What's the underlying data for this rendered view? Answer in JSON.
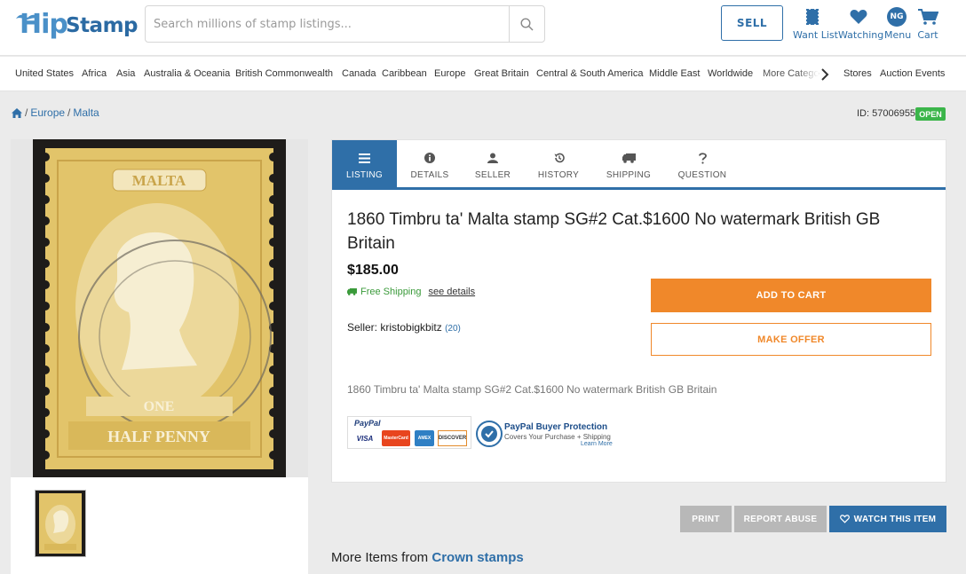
{
  "header": {
    "logo_part1": "Hip",
    "logo_part2": "Stamp",
    "search_placeholder": "Search millions of stamp listings...",
    "sell_label": "SELL",
    "icons": [
      {
        "label": "Want List",
        "icon": "stamp-icon"
      },
      {
        "label": "Watching",
        "icon": "heart-icon"
      },
      {
        "label": "Menu",
        "icon": "avatar",
        "initials": "NG"
      },
      {
        "label": "Cart",
        "icon": "cart-icon"
      }
    ]
  },
  "categories": [
    "United States",
    "Africa",
    "Asia",
    "Australia & Oceania",
    "British Commonwealth",
    "Canada",
    "Caribbean",
    "Europe",
    "Great Britain",
    "Central & South America",
    "Middle East",
    "Worldwide",
    "More Catego",
    "Stores",
    "Auction Events"
  ],
  "breadcrumb": {
    "home_icon": "home-icon",
    "items": [
      "Europe",
      "Malta"
    ]
  },
  "listing_id": "ID: 57006955",
  "status_badge": "OPEN",
  "tabs": [
    {
      "label": "LISTING",
      "icon": "list-icon",
      "active": true
    },
    {
      "label": "DETAILS",
      "icon": "info-icon"
    },
    {
      "label": "SELLER",
      "icon": "user-icon"
    },
    {
      "label": "HISTORY",
      "icon": "history-icon"
    },
    {
      "label": "SHIPPING",
      "icon": "truck-icon"
    },
    {
      "label": "QUESTION",
      "icon": "question-icon"
    }
  ],
  "listing": {
    "title": "1860 Timbru ta' Malta stamp SG#2 Cat.$1600 No watermark British GB Britain",
    "price": "$185.00",
    "free_shipping": "Free Shipping",
    "see_details": "see details",
    "seller_label": "Seller:",
    "seller_name": "kristobigkbitz",
    "seller_count": "(20)",
    "add_to_cart": "ADD TO CART",
    "make_offer": "MAKE OFFER",
    "description": "1860 Timbru ta' Malta stamp SG#2 Cat.$1600 No watermark British GB Britain"
  },
  "image_caption": {
    "stamp_top": "MALTA",
    "stamp_mid": "ONE",
    "stamp_bottom": "HALF PENNY"
  },
  "payment": {
    "paypal": "PayPal",
    "cards": [
      "VISA",
      "MasterCard",
      "AMEX",
      "DISCOVER"
    ],
    "protection_title": "PayPal Buyer Protection",
    "protection_sub": "Covers Your Purchase + Shipping",
    "learn_more": "Learn More"
  },
  "actions": {
    "print": "PRINT",
    "report": "REPORT ABUSE",
    "watch": "WATCH THIS ITEM"
  },
  "more_items": {
    "prefix": "More Items from",
    "store": "Crown stamps"
  },
  "colors": {
    "brand_blue": "#2f6fa8",
    "orange": "#f0882a",
    "open_green": "#3bb54a",
    "stamp_yellow": "#e2c46a"
  }
}
